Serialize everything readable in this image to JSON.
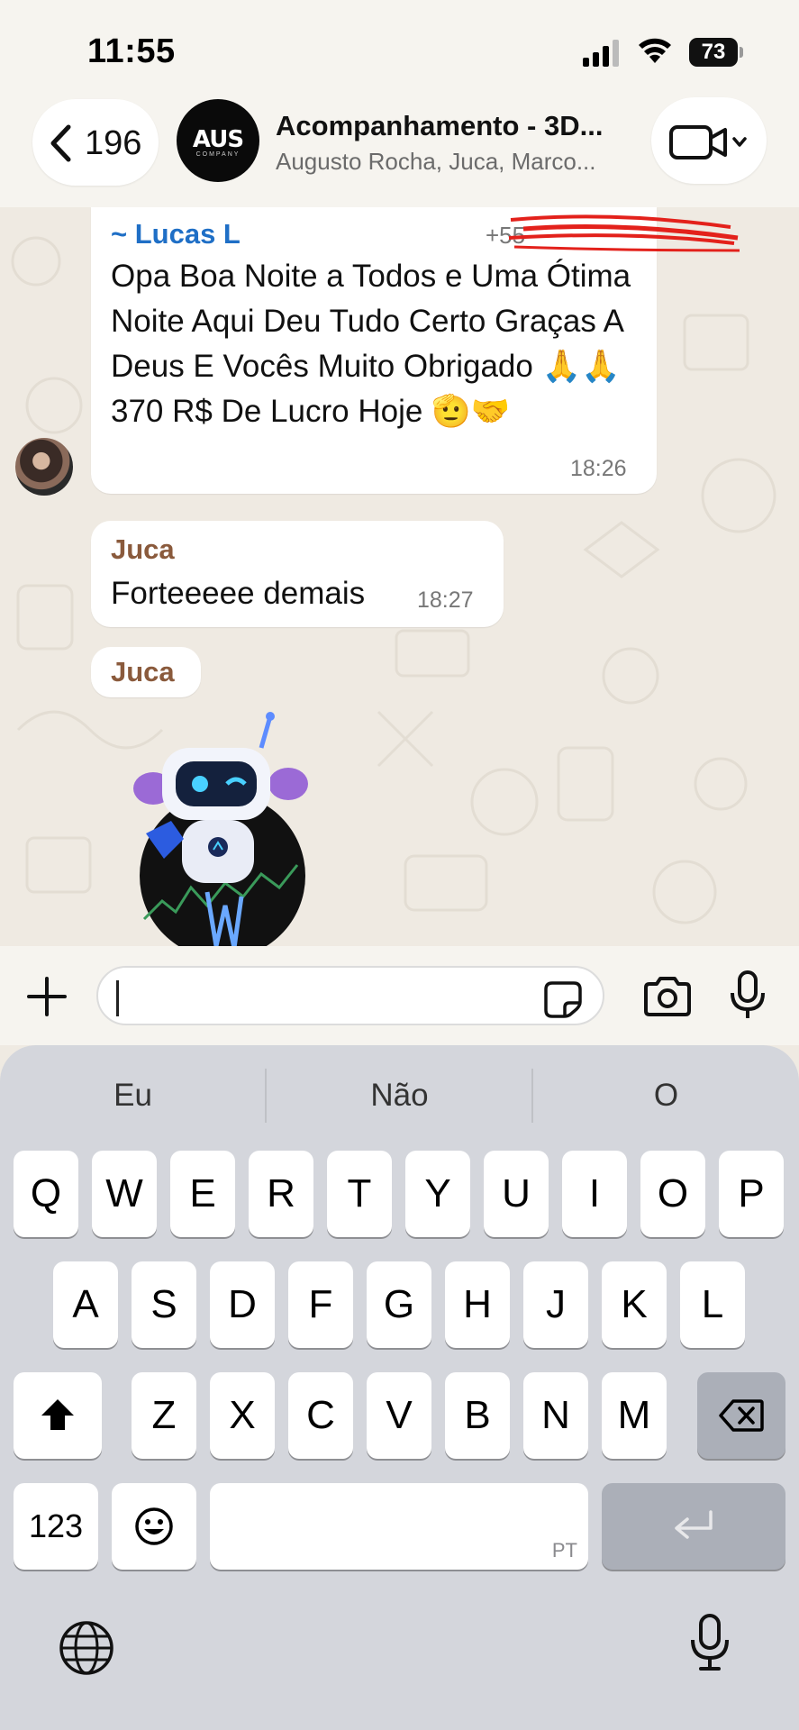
{
  "status_bar": {
    "time": "11:55",
    "battery": "73"
  },
  "header": {
    "back_count": "196",
    "avatar_logo": "AUS",
    "avatar_logo_sub": "COMPANY",
    "title": "Acompanhamento - 3D...",
    "subtitle": "Augusto Rocha, Juca, Marco..."
  },
  "messages": [
    {
      "sender": "~ Lucas L",
      "phone": "+55",
      "text": "Opa Boa Noite a Todos e Uma Ótima Noite Aqui Deu Tudo Certo Graças A Deus E Vocês Muito Obrigado 🙏🙏 370 R$ De Lucro Hoje 🫡🤝",
      "time": "18:26"
    },
    {
      "sender": "Juca",
      "text": "Forteeeee demais",
      "time": "18:27"
    },
    {
      "sender": "Juca"
    }
  ],
  "input": {
    "placeholder": ""
  },
  "keyboard": {
    "suggestions": [
      "Eu",
      "Não",
      "O"
    ],
    "row1": [
      "Q",
      "W",
      "E",
      "R",
      "T",
      "Y",
      "U",
      "I",
      "O",
      "P"
    ],
    "row2": [
      "A",
      "S",
      "D",
      "F",
      "G",
      "H",
      "J",
      "K",
      "L"
    ],
    "row3": [
      "Z",
      "X",
      "C",
      "V",
      "B",
      "N",
      "M"
    ],
    "numbers_key": "123",
    "language_hint": "PT"
  },
  "colors": {
    "sender_lucas": "#1f6fc6",
    "sender_juca": "#8a5a3c",
    "chat_bg": "#efeae2"
  }
}
